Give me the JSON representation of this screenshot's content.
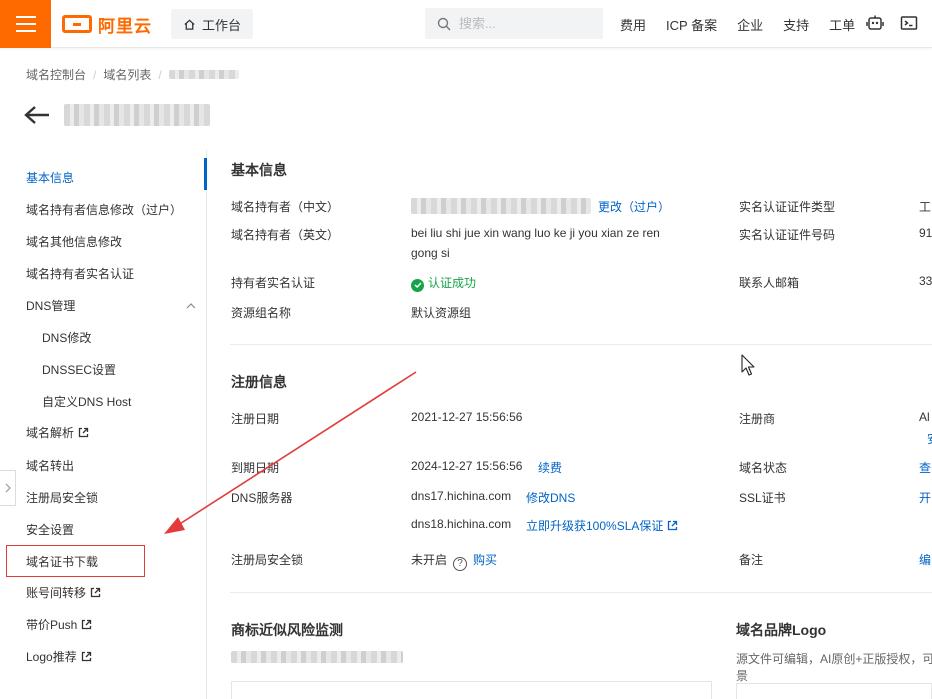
{
  "topbar": {
    "brand": "阿里云",
    "workbench": "工作台",
    "search_placeholder": "搜索...",
    "links": [
      "费用",
      "ICP 备案",
      "企业",
      "支持",
      "工单"
    ]
  },
  "breadcrumb": [
    "域名控制台",
    "域名列表"
  ],
  "sidebar": {
    "items": [
      {
        "label": "基本信息",
        "active": true
      },
      {
        "label": "域名持有者信息修改（过户）"
      },
      {
        "label": "域名其他信息修改"
      },
      {
        "label": "域名持有者实名认证"
      },
      {
        "label": "DNS管理"
      },
      {
        "label": "DNS修改",
        "sub": true
      },
      {
        "label": "DNSSEC设置",
        "sub": true
      },
      {
        "label": "自定义DNS Host",
        "sub": true
      },
      {
        "label": "域名解析",
        "external": true
      },
      {
        "label": "域名转出"
      },
      {
        "label": "注册局安全锁"
      },
      {
        "label": "安全设置"
      },
      {
        "label": "域名证书下载"
      },
      {
        "label": "账号间转移",
        "external": true
      },
      {
        "label": "带价Push",
        "external": true
      },
      {
        "label": "Logo推荐",
        "external": true
      }
    ]
  },
  "basic": {
    "title": "基本信息",
    "owner_cn_label": "域名持有者（中文）",
    "owner_cn_action": "更改（过户）",
    "owner_en_label": "域名持有者（英文）",
    "owner_en_value_1": "bei liu shi jue xin wang luo ke ji you xian ze ren",
    "owner_en_value_2": "gong si",
    "verify_label": "持有者实名认证",
    "verify_value": "认证成功",
    "group_label": "资源组名称",
    "group_value": "默认资源组",
    "cert_type_label": "实名认证证件类型",
    "cert_type_value": "工",
    "cert_no_label": "实名认证证件号码",
    "cert_no_value": "91",
    "email_label": "联系人邮箱",
    "email_value": "33"
  },
  "registration": {
    "title": "注册信息",
    "reg_date_label": "注册日期",
    "reg_date_value": "2021-12-27 15:56:56",
    "exp_date_label": "到期日期",
    "exp_date_value": "2024-12-27 15:56:56",
    "renew": "续费",
    "dns_label": "DNS服务器",
    "dns1": "dns17.hichina.com",
    "dns_modify": "修改DNS",
    "dns2": "dns18.hichina.com",
    "dns_upgrade": "立即升级获100%SLA保证",
    "lock_label": "注册局安全锁",
    "lock_value": "未开启",
    "lock_buy": "购买",
    "registrar_label": "注册商",
    "registrar_value": "Al",
    "registrar_value_2": "安",
    "status_label": "域名状态",
    "status_value": "查",
    "ssl_label": "SSL证书",
    "ssl_value": "开",
    "remark_label": "备注",
    "remark_value": "编"
  },
  "trademark": {
    "title": "商标近似风险监测"
  },
  "brand_logo": {
    "title": "域名品牌Logo",
    "desc_1": "源文件可编辑，AI原创+正版授权，可",
    "desc_2": "景"
  },
  "colors": {
    "brand": "#ff6a00",
    "link": "#0064c8",
    "success": "#16a34a",
    "annotation": "#e23b3b"
  }
}
